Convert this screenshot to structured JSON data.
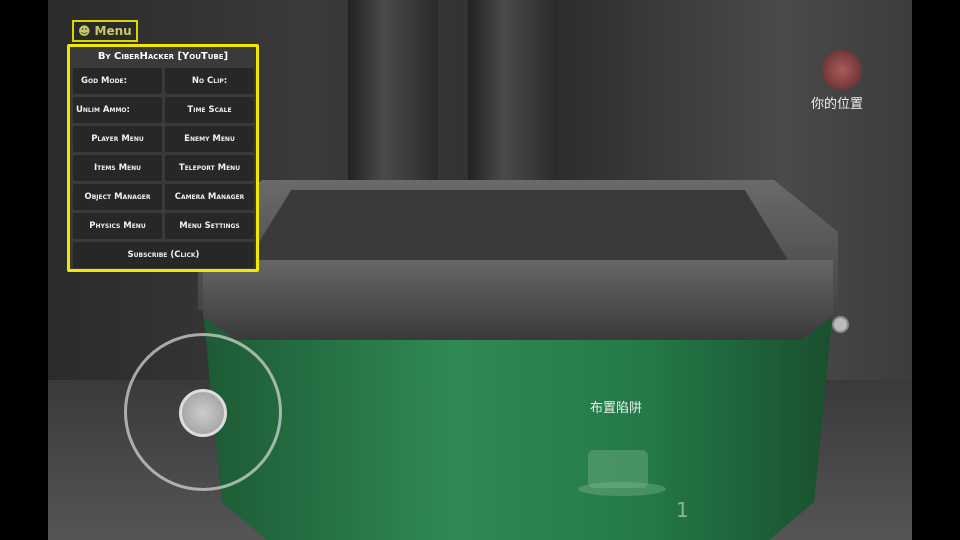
{
  "menu_tab": {
    "label": "Menu",
    "icon": "mask-icon"
  },
  "panel": {
    "title": "By CiberHacker [YouTube]",
    "buttons": [
      "God Mode:",
      "No Clip:",
      "Unlim Ammo:",
      "Time Scale",
      "Player Menu",
      "Enemy Menu",
      "Items Menu",
      "Teleport Menu",
      "Object Manager",
      "Camera Manager",
      "Physics Menu",
      "Menu Settings"
    ],
    "subscribe": "Subscribe (Click)"
  },
  "hud": {
    "your_position": "你的位置",
    "set_trap": "布置陷阱",
    "trap_count": "1"
  },
  "colors": {
    "menu_border": "#f0e800",
    "water": "#2f8a55"
  }
}
